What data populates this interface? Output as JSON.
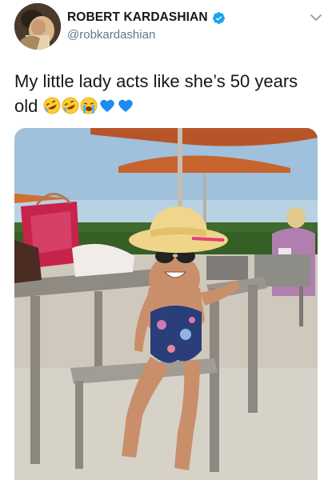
{
  "tweet": {
    "display_name": "ROBERT KARDASHIAN",
    "handle": "@robkardashian",
    "text": "My little lady acts like she’s 50 years old",
    "emojis": [
      "rolling-on-floor-laughing",
      "rolling-on-floor-laughing",
      "loudly-crying-face",
      "blue-heart",
      "blue-heart"
    ],
    "icons": {
      "verified": "verified-badge-icon",
      "menu": "chevron-down-icon"
    },
    "image_alt": "Little girl in a straw sun hat, sunglasses and a patterned swimsuit sitting on a patio chair under orange umbrellas",
    "colors": {
      "verified_blue": "#1da1f2",
      "handle_gray": "#657786",
      "text": "#14171a"
    }
  }
}
